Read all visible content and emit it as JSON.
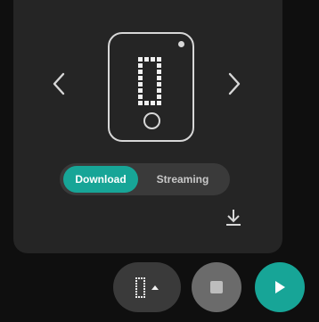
{
  "device_viewer": {
    "prev_icon": "chevron-left-icon",
    "next_icon": "chevron-right-icon",
    "device_icon": "phone-led-matrix-icon"
  },
  "mode_toggle": {
    "download_label": "Download",
    "streaming_label": "Streaming",
    "selected": "Download"
  },
  "actions": {
    "download_icon": "download-icon",
    "device_selector_icon": "led-matrix-device-icon",
    "caret_icon": "caret-up-icon",
    "stop_icon": "stop-icon",
    "play_icon": "play-icon"
  },
  "colors": {
    "accent": "#17a597",
    "panel": "#252525",
    "background": "#0f0f0f",
    "toggle_track": "#3a3a3a",
    "stop_button": "#6b6b6b"
  }
}
